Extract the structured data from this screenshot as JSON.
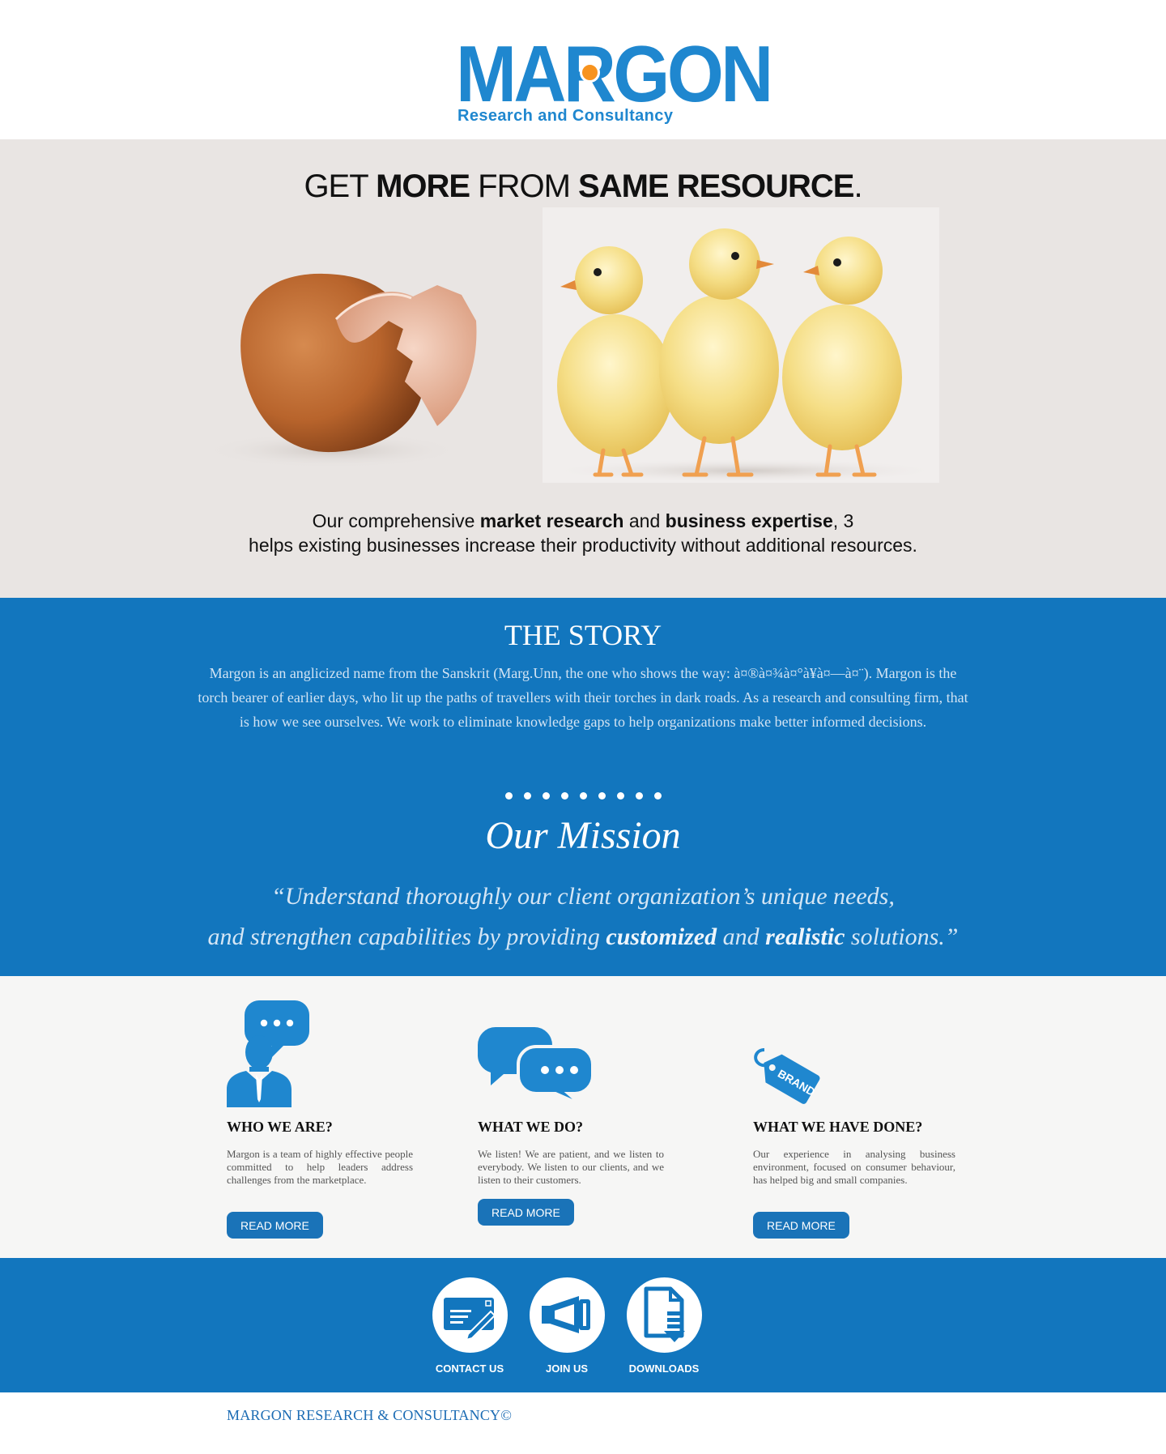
{
  "colors": {
    "brand_blue": "#1276be",
    "logo_blue": "#1f87cf",
    "logo_orange": "#f7931e",
    "hero_bg": "#e9e5e3",
    "features_bg": "#f6f6f5",
    "button_blue": "#1a73b8"
  },
  "logo": {
    "word": "MARGON",
    "tagline": "Research and Consultancy"
  },
  "hero": {
    "headline": {
      "part1": "GET ",
      "part2": "MORE",
      "part3": " FROM ",
      "part4": "SAME RESOURCE",
      "part5": "."
    },
    "image_alt_icons": [
      "cracked-egg-shell",
      "three-chicks"
    ],
    "line1": {
      "a": "Our comprehensive ",
      "b": "market research",
      "c": " and ",
      "d": "business expertise",
      "e": ", 3"
    },
    "line2": "helps existing businesses increase their productivity without additional resources."
  },
  "story": {
    "title": "THE STORY",
    "text": "Margon is an anglicized name from the Sanskrit (Marg.Unn, the one who shows the way: à¤®à¤¾à¤°à¥à¤—à¤¨). Margon is the torch bearer of earlier days, who lit up the paths of travellers with their torches in dark roads. As a research and consulting firm, that is how we see ourselves. We work to eliminate knowledge gaps to help organizations make better informed decisions.",
    "dot_count": 9
  },
  "mission": {
    "title": "Our Mission",
    "quote_line1": "“Understand thoroughly our client organization’s unique needs,",
    "quote_line2": {
      "a": "and strengthen capabilities by providing ",
      "b": "customized",
      "c": " and ",
      "d": "realistic",
      "e": " solutions.”"
    }
  },
  "features": [
    {
      "icon": "businessman-speech-icon",
      "title": "WHO WE ARE?",
      "text": "Margon is a team of highly effective people committed to help leaders address challenges from the marketplace.",
      "button": "READ MORE"
    },
    {
      "icon": "chat-bubbles-icon",
      "title": "WHAT WE DO?",
      "text": "We listen! We are patient, and we listen to everybody. We listen to our clients, and we listen to their customers.",
      "button": "READ MORE"
    },
    {
      "icon": "brand-tag-icon",
      "title": "WHAT WE HAVE DONE?",
      "text": "Our experience in analysing business environment, focused on consumer behaviour, has helped big and small companies.",
      "button": "READ MORE",
      "tag_text": "BRAND"
    }
  ],
  "links": [
    {
      "icon": "contact-card-icon",
      "label": "CONTACT US"
    },
    {
      "icon": "megaphone-icon",
      "label": "JOIN US"
    },
    {
      "icon": "download-document-icon",
      "label": "DOWNLOADS"
    }
  ],
  "footer": {
    "copyright": "MARGON RESEARCH & CONSULTANCY©"
  }
}
